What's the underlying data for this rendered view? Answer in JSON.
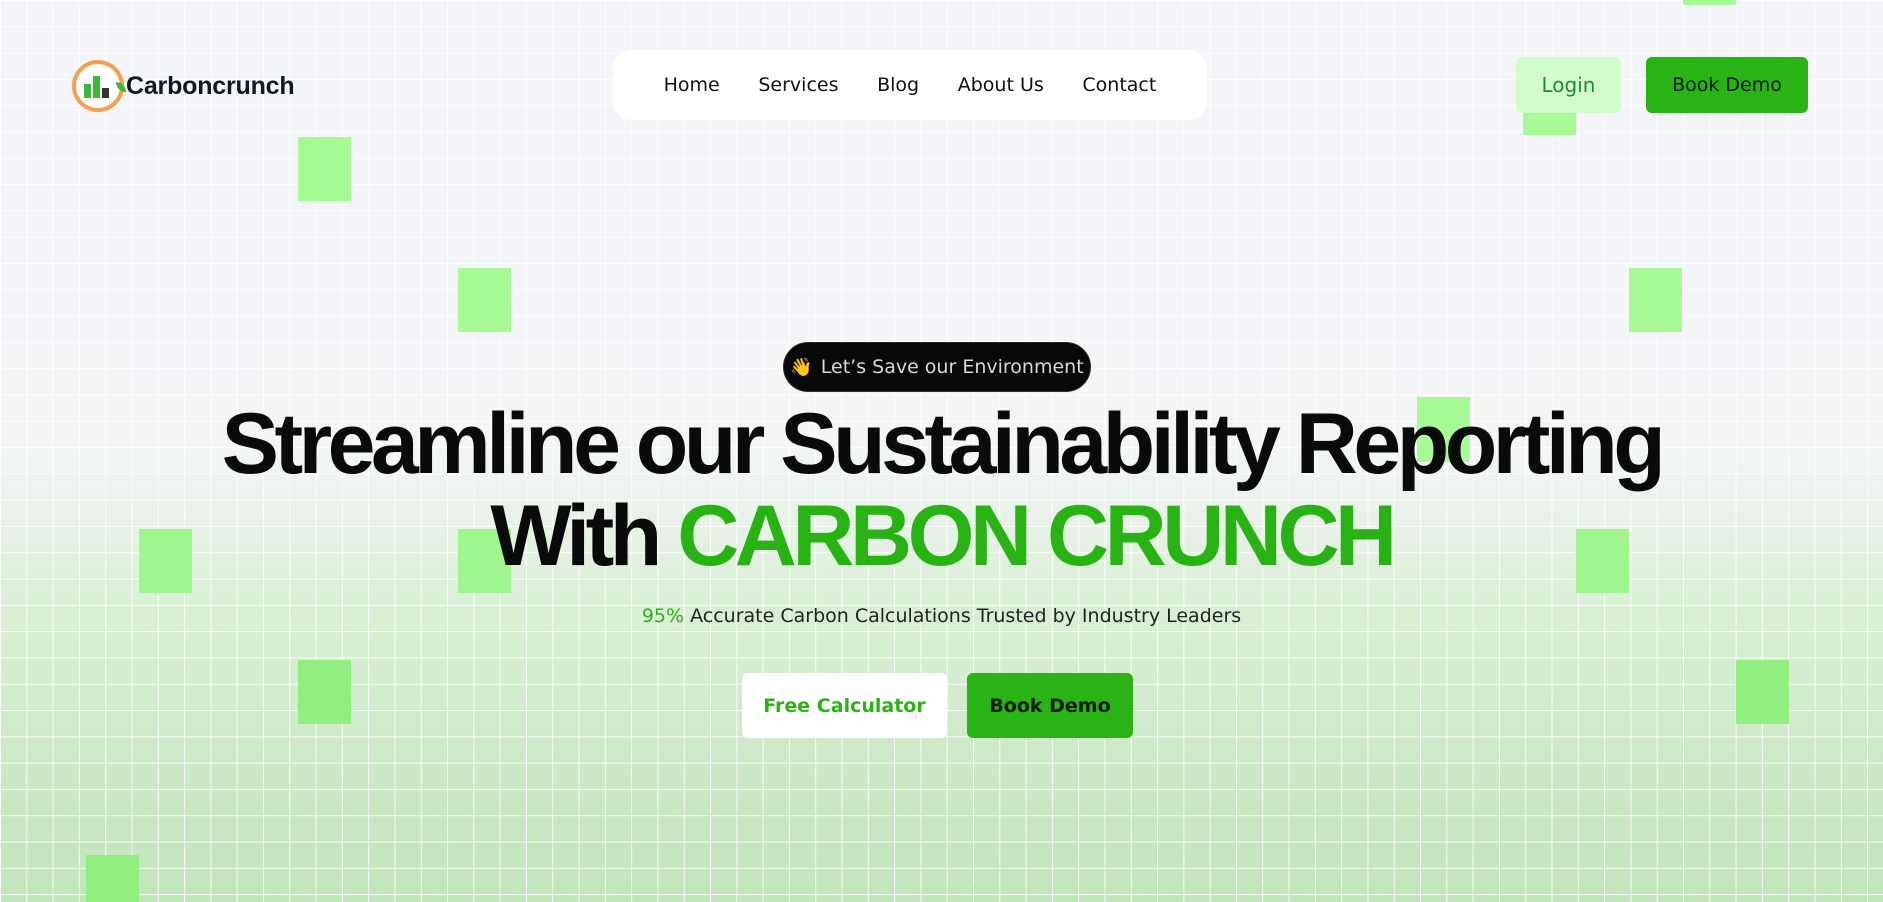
{
  "brand": {
    "name": "Carboncrunch",
    "logo_icon": "carbon-chart-logo"
  },
  "nav": {
    "items": [
      {
        "label": "Home"
      },
      {
        "label": "Services"
      },
      {
        "label": "Blog"
      },
      {
        "label": "About Us"
      },
      {
        "label": "Contact"
      }
    ]
  },
  "header": {
    "login_label": "Login",
    "demo_label": "Book Demo"
  },
  "hero": {
    "pill_icon": "👋",
    "pill_text": "Let’s Save our Environment",
    "headline_line1": "Streamline our Sustainability Reporting",
    "headline_line2_prefix": "With ",
    "headline_line2_accent": "CARBON CRUNCH",
    "stat_percent": "95%",
    "stat_text": " Accurate Carbon Calculations Trusted by Industry Leaders",
    "cta_calculator": "Free Calculator",
    "cta_demo": "Book Demo"
  },
  "colors": {
    "accent": "#2ab314",
    "light_accent": "#d3fccb",
    "square": "#a6fb97",
    "background": "#f4f5f9"
  }
}
